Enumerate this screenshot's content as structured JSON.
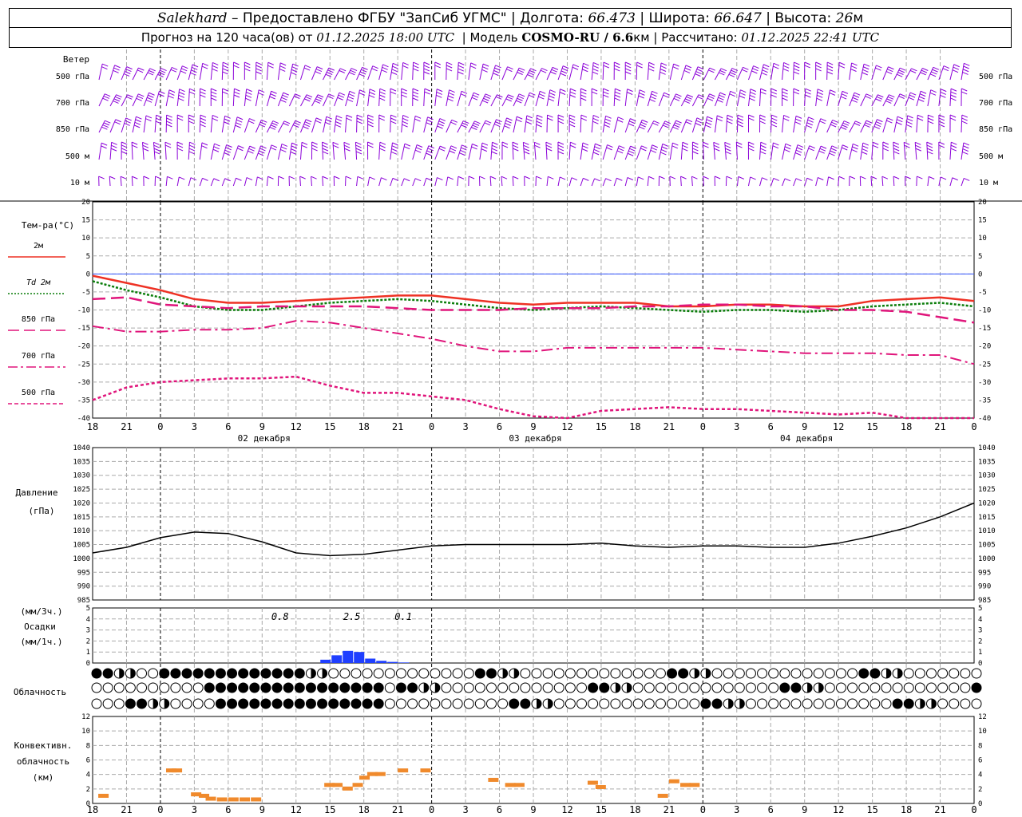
{
  "header": {
    "station": "Salekhard",
    "dash": "–",
    "provider": "Предоставлено ФГБУ \"ЗапСиб УГМС\"",
    "lon_label": "Долгота:",
    "lon_value": "66.473",
    "lat_label": "Широта:",
    "lat_value": "66.647",
    "alt_label": "Высота:",
    "alt_value": "26",
    "alt_unit": "м",
    "sep": "|",
    "forecast_prefix": "Прогноз на 120 часа(ов) от",
    "forecast_time": "01.12.2025 18:00 UTC",
    "model_label": "Модель",
    "model_name": "COSMO-RU / 6.6",
    "model_unit": "км",
    "calc_label": "Рассчитано:",
    "calc_time": "01.12.2025 22:41 UTC"
  },
  "wind_panel": {
    "title": "Ветер",
    "levels": [
      "500 гПа",
      "700 гПа",
      "850 гПа",
      "500 м",
      "10  м"
    ],
    "barb_color": "#8b00d8"
  },
  "temp_panel": {
    "title": "Тем-ра(°C)",
    "legend": [
      {
        "label": "2м",
        "color": "#ee3124",
        "dash": "solid"
      },
      {
        "label": "Td  2м",
        "color": "#0a7d0a",
        "dash": "dot"
      },
      {
        "label": "850 гПа",
        "color": "#e0157b",
        "dash": "longdash"
      },
      {
        "label": "700 гПа",
        "color": "#e0157b",
        "dash": "dashdot"
      },
      {
        "label": "500 гПа",
        "color": "#e0157b",
        "dash": "short"
      }
    ],
    "ylim": [
      -40,
      20
    ],
    "yticks": [
      "20",
      "15",
      "10",
      "5",
      "0",
      "-5",
      "-10",
      "-15",
      "-20",
      "-25",
      "-30",
      "-35",
      "-40"
    ]
  },
  "time_axis": {
    "hour_labels": [
      "18",
      "21",
      "0",
      "3",
      "6",
      "9",
      "12",
      "15",
      "18",
      "21",
      "0",
      "3",
      "6",
      "9",
      "12",
      "15",
      "18",
      "21",
      "0",
      "3",
      "6",
      "9",
      "12",
      "15",
      "18",
      "21",
      "0"
    ],
    "day_labels": [
      "02 декабря",
      "03 декабря",
      "04 декабря"
    ]
  },
  "pressure_panel": {
    "title": "Давление",
    "unit": "(гПа)",
    "ylim": [
      985,
      1040
    ],
    "yticks": [
      "1040",
      "1035",
      "1030",
      "1025",
      "1020",
      "1015",
      "1010",
      "1005",
      "1000",
      "995",
      "990",
      "985"
    ]
  },
  "precip_panel": {
    "unit_top": "(мм/3ч.)",
    "title": "Осадки",
    "unit_bottom": "(мм/1ч.)",
    "yticks": [
      "5",
      "4",
      "3",
      "2",
      "1",
      "0"
    ],
    "totals": [
      "0.8",
      "2.5",
      "0.1"
    ],
    "bar_color": "#1f3fff"
  },
  "cloud_panel": {
    "title": "Облачность"
  },
  "conv_panel": {
    "title_1": "Конвективн.",
    "title_2": "облачность",
    "unit": "(км)",
    "yticks": [
      "12",
      "10",
      "8",
      "6",
      "4",
      "2",
      "0"
    ],
    "bar_color": "#f08a2c"
  },
  "chart_data": {
    "type": "line",
    "time_hours_from_start": [
      0,
      3,
      6,
      9,
      12,
      15,
      18,
      21,
      24,
      27,
      30,
      33,
      36,
      39,
      42,
      45,
      48,
      51,
      54,
      57,
      60,
      63,
      66,
      69,
      72,
      75,
      78
    ],
    "series": [
      {
        "name": "2м",
        "x": [
          0,
          3,
          6,
          9,
          12,
          15,
          18,
          21,
          24,
          27,
          30,
          33,
          36,
          39,
          42,
          45,
          48,
          51,
          54,
          57,
          60,
          63,
          66,
          69,
          72,
          75,
          78
        ],
        "values": [
          -0.5,
          -2.5,
          -4.5,
          -7,
          -8,
          -8,
          -7.5,
          -7,
          -6.5,
          -6,
          -6,
          -7,
          -8,
          -8.5,
          -8,
          -8,
          -8,
          -9,
          -9,
          -8.5,
          -8.5,
          -9,
          -9,
          -7.5,
          -7,
          -6.5,
          -7.5
        ]
      },
      {
        "name": "Td  2м",
        "x": [
          0,
          3,
          6,
          9,
          12,
          15,
          18,
          21,
          24,
          27,
          30,
          33,
          36,
          39,
          42,
          45,
          48,
          51,
          54,
          57,
          60,
          63,
          66,
          69,
          72,
          75,
          78
        ],
        "values": [
          -2,
          -4.5,
          -6.5,
          -9,
          -10,
          -10,
          -9,
          -8,
          -7.5,
          -7,
          -7.5,
          -8.5,
          -9.5,
          -10,
          -9.5,
          -9,
          -9.5,
          -10,
          -10.5,
          -10,
          -10,
          -10.5,
          -10,
          -9,
          -8.5,
          -8,
          -9
        ]
      },
      {
        "name": "850 гПа",
        "values": [
          -7,
          -6.5,
          -8.5,
          -9,
          -9.5,
          -9,
          -9,
          -9,
          -9,
          -9.5,
          -10,
          -10,
          -10,
          -9.5,
          -9.5,
          -9.5,
          -9,
          -9,
          -8.5,
          -8.5,
          -9,
          -9,
          -10,
          -10,
          -10.5,
          -12,
          -13.5
        ]
      },
      {
        "name": "700 гПа",
        "values": [
          -14.5,
          -16,
          -16,
          -15.5,
          -15.5,
          -15,
          -13,
          -13.5,
          -15,
          -16.5,
          -18,
          -20,
          -21.5,
          -21.5,
          -20.5,
          -20.5,
          -20.5,
          -20.5,
          -20.5,
          -21,
          -21.5,
          -22,
          -22,
          -22,
          -22.5,
          -22.5,
          -25
        ]
      },
      {
        "name": "500 гПа",
        "values": [
          -35,
          -31.5,
          -30,
          -29.5,
          -29,
          -29,
          -28.5,
          -31,
          -33,
          -33,
          -34,
          -35,
          -37.5,
          -39.5,
          -40.5,
          -38,
          -37.5,
          -37,
          -37.5,
          -37.5,
          -38,
          -38.5,
          -39,
          -38.5,
          -40,
          -42,
          -42
        ]
      },
      {
        "name": "pressure",
        "values": [
          1002,
          1004,
          1007.5,
          1009.5,
          1009,
          1006,
          1002,
          1001,
          1001.5,
          1003,
          1004.5,
          1005,
          1005,
          1005,
          1005,
          1005.5,
          1004.5,
          1004,
          1004.5,
          1004.5,
          1004,
          1004,
          1005.5,
          1008,
          1011,
          1015,
          1020
        ]
      }
    ],
    "xlabel": "",
    "ylabel": "",
    "ylim": [
      -40,
      20
    ],
    "precip_totals": [
      "0.8",
      "2.5",
      "0.1"
    ]
  }
}
